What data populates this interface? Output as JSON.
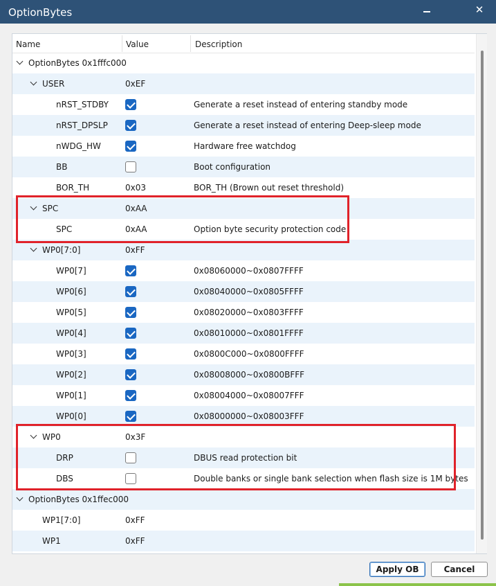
{
  "window": {
    "title": "OptionBytes"
  },
  "columns": {
    "name": "Name",
    "value": "Value",
    "description": "Description"
  },
  "rows": [
    {
      "name": "OptionBytes 0x1fffc000",
      "value": "",
      "description": "",
      "chevron": true
    },
    {
      "name": "USER",
      "value": "0xEF",
      "description": "",
      "chevron": true
    },
    {
      "name": "nRST_STDBY",
      "checked": true,
      "description": "Generate a reset instead of entering standby mode"
    },
    {
      "name": "nRST_DPSLP",
      "checked": true,
      "description": "Generate a reset instead of entering Deep-sleep mode"
    },
    {
      "name": "nWDG_HW",
      "checked": true,
      "description": "Hardware free watchdog"
    },
    {
      "name": "BB",
      "checked": false,
      "description": "Boot configuration"
    },
    {
      "name": "BOR_TH",
      "value": "0x03",
      "description": "BOR_TH (Brown out reset threshold)"
    },
    {
      "name": "SPC",
      "value": "0xAA",
      "description": "",
      "chevron": true
    },
    {
      "name": "SPC",
      "value": "0xAA",
      "description": "Option byte security protection code"
    },
    {
      "name": "WP0[7:0]",
      "value": "0xFF",
      "description": "",
      "chevron": true
    },
    {
      "name": "WP0[7]",
      "checked": true,
      "description": "0x08060000~0x0807FFFF"
    },
    {
      "name": "WP0[6]",
      "checked": true,
      "description": "0x08040000~0x0805FFFF"
    },
    {
      "name": "WP0[5]",
      "checked": true,
      "description": "0x08020000~0x0803FFFF"
    },
    {
      "name": "WP0[4]",
      "checked": true,
      "description": "0x08010000~0x0801FFFF"
    },
    {
      "name": "WP0[3]",
      "checked": true,
      "description": "0x0800C000~0x0800FFFF"
    },
    {
      "name": "WP0[2]",
      "checked": true,
      "description": "0x08008000~0x0800BFFF"
    },
    {
      "name": "WP0[1]",
      "checked": true,
      "description": "0x08004000~0x08007FFF"
    },
    {
      "name": "WP0[0]",
      "checked": true,
      "description": "0x08000000~0x08003FFF"
    },
    {
      "name": "WP0",
      "value": "0x3F",
      "description": "",
      "chevron": true
    },
    {
      "name": "DRP",
      "checked": false,
      "description": "DBUS read protection bit"
    },
    {
      "name": "DBS",
      "checked": false,
      "description": "Double banks or single bank selection when flash size is 1M bytes"
    },
    {
      "name": "OptionBytes 0x1ffec000",
      "value": "",
      "description": "",
      "chevron": true
    },
    {
      "name": "WP1[7:0]",
      "value": "0xFF",
      "description": ""
    },
    {
      "name": "WP1",
      "value": "0xFF",
      "description": ""
    }
  ],
  "buttons": {
    "apply": "Apply OB",
    "cancel": "Cancel"
  },
  "colors": {
    "titlebar": "#2e5277",
    "highlight": "#e0222a",
    "checkbox": "#1a67c2",
    "row_alt": "#eaf3fb"
  }
}
